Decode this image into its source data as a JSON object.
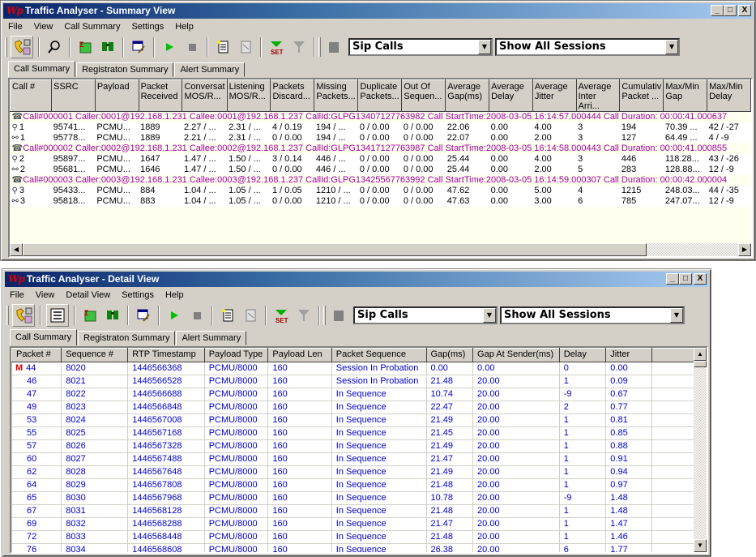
{
  "summary_window": {
    "logo": "Wp",
    "title": "Traffic Analyser - Summary View",
    "window_buttons": {
      "minimize": "_",
      "maximize": "□",
      "close": "X"
    },
    "menu": [
      "File",
      "View",
      "Call Summary",
      "Settings",
      "Help"
    ],
    "filter_combo": "Sip Calls",
    "session_combo": "Show All Sessions",
    "tabs": [
      "Call Summary",
      "Registraton Summary",
      "Alert Summary"
    ],
    "columns": [
      "Call #",
      "SSRC",
      "Payload",
      "Packet Received",
      "Conversat MOS/R...",
      "Listening MOS/R...",
      "Packets Discard...",
      "Missing Packets...",
      "Duplicate Packets...",
      "Out Of Sequen...",
      "Average Gap(ms)",
      "Average Delay",
      "Average Jitter",
      "Average Inter Arri...",
      "Cumulativ Packet ...",
      "Max/Min Gap",
      "Max/Min Delay"
    ],
    "calls": [
      {
        "header": "Call#000001  Caller:0001@192.168.1.231 Callee:0001@192.168.1.237 CallId:GLPG13407127763982 Call StartTime:2008-03-05 16:14:57.000444 Call Duration: 00:00:41.000637",
        "streams": [
          [
            "1",
            "95741...",
            "PCMU...",
            "1889",
            "2.27 / ...",
            "2.31 / ...",
            "4 / 0.19",
            "194 / ...",
            "0 / 0.00",
            "0 / 0.00",
            "22.06",
            "0.00",
            "4.00",
            "3",
            "194",
            "70.39 ...",
            "42 / -27"
          ],
          [
            "1",
            "95778...",
            "PCMU...",
            "1889",
            "2.21 / ...",
            "2.31 / ...",
            "0 / 0.00",
            "194 / ...",
            "0 / 0.00",
            "0 / 0.00",
            "22.07",
            "0.00",
            "2.00",
            "3",
            "127",
            "64.49 ...",
            "4 / -9"
          ]
        ]
      },
      {
        "header": "Call#000002  Caller:0002@192.168.1.231 Callee:0002@192.168.1.237 CallId:GLPG13417127763987 Call StartTime:2008-03-05 16:14:58.000443 Call Duration: 00:00:41.000855",
        "streams": [
          [
            "2",
            "95897...",
            "PCMU...",
            "1647",
            "1.47 / ...",
            "1.50 / ...",
            "3 / 0.14",
            "446 / ...",
            "0 / 0.00",
            "0 / 0.00",
            "25.44",
            "0.00",
            "4.00",
            "3",
            "446",
            "118.28...",
            "43 / -26"
          ],
          [
            "2",
            "95681...",
            "PCMU...",
            "1646",
            "1.47 / ...",
            "1.50 / ...",
            "0 / 0.00",
            "446 / ...",
            "0 / 0.00",
            "0 / 0.00",
            "25.44",
            "0.00",
            "2.00",
            "5",
            "283",
            "128.88...",
            "12 / -9"
          ]
        ]
      },
      {
        "header": "Call#000003  Caller:0003@192.168.1.231 Callee:0003@192.168.1.237 CallId:GLPG13425567763992 Call StartTime:2008-03-05 16:14:59.000307 Call Duration: 00:00:42.000004",
        "streams": [
          [
            "3",
            "95433...",
            "PCMU...",
            "884",
            "1.04 / ...",
            "1.05 / ...",
            "1 / 0.05",
            "1210 / ...",
            "0 / 0.00",
            "0 / 0.00",
            "47.62",
            "0.00",
            "5.00",
            "4",
            "1215",
            "248.03...",
            "44 / -35"
          ],
          [
            "3",
            "95818...",
            "PCMU...",
            "883",
            "1.04 / ...",
            "1.05 / ...",
            "0 / 0.00",
            "1210 / ...",
            "0 / 0.00",
            "0 / 0.00",
            "47.63",
            "0.00",
            "3.00",
            "6",
            "785",
            "247.07...",
            "12 / -9"
          ]
        ]
      }
    ]
  },
  "detail_window": {
    "logo": "Wp",
    "title": "Traffic Analyser - Detail View",
    "window_buttons": {
      "minimize": "_",
      "maximize": "□",
      "close": "X"
    },
    "menu": [
      "File",
      "View",
      "Detail View",
      "Settings",
      "Help"
    ],
    "filter_combo": "Sip Calls",
    "session_combo": "Show All Sessions",
    "tabs": [
      "Call Summary",
      "Registraton Summary",
      "Alert Summary"
    ],
    "columns": [
      "Packet #",
      "Sequence #",
      "RTP Timestamp",
      "Payload Type",
      "Payload Len",
      "Packet Sequence",
      "Gap(ms)",
      "Gap At Sender(ms)",
      "Delay",
      "Jitter",
      ""
    ],
    "marker_label": "M",
    "rows": [
      [
        "44",
        "8020",
        "1446566368",
        "PCMU/8000",
        "160",
        "Session In Probation",
        " 0.00",
        " 0.00",
        "0",
        "0.00"
      ],
      [
        "46",
        "8021",
        "1446566528",
        "PCMU/8000",
        "160",
        "Session In Probation",
        "21.48",
        "20.00",
        "1",
        "0.09"
      ],
      [
        "47",
        "8022",
        "1446566688",
        "PCMU/8000",
        "160",
        "In Sequence",
        "10.74",
        "20.00",
        "-9",
        "0.67"
      ],
      [
        "49",
        "8023",
        "1446566848",
        "PCMU/8000",
        "160",
        "In Sequence",
        "22.47",
        "20.00",
        "2",
        "0.77"
      ],
      [
        "53",
        "8024",
        "1446567008",
        "PCMU/8000",
        "160",
        "In Sequence",
        "21.49",
        "20.00",
        "1",
        "0.81"
      ],
      [
        "55",
        "8025",
        "1446567168",
        "PCMU/8000",
        "160",
        "In Sequence",
        "21.45",
        "20.00",
        "1",
        "0.85"
      ],
      [
        "57",
        "8026",
        "1446567328",
        "PCMU/8000",
        "160",
        "In Sequence",
        "21.49",
        "20.00",
        "1",
        "0.88"
      ],
      [
        "60",
        "8027",
        "1446567488",
        "PCMU/8000",
        "160",
        "In Sequence",
        "21.47",
        "20.00",
        "1",
        "0.91"
      ],
      [
        "62",
        "8028",
        "1446567648",
        "PCMU/8000",
        "160",
        "In Sequence",
        "21.49",
        "20.00",
        "1",
        "0.94"
      ],
      [
        "64",
        "8029",
        "1446567808",
        "PCMU/8000",
        "160",
        "In Sequence",
        "21.48",
        "20.00",
        "1",
        "0.97"
      ],
      [
        "65",
        "8030",
        "1446567968",
        "PCMU/8000",
        "160",
        "In Sequence",
        "10.78",
        "20.00",
        "-9",
        "1.48"
      ],
      [
        "67",
        "8031",
        "1446568128",
        "PCMU/8000",
        "160",
        "In Sequence",
        "21.48",
        "20.00",
        "1",
        "1.48"
      ],
      [
        "69",
        "8032",
        "1446568288",
        "PCMU/8000",
        "160",
        "In Sequence",
        "21.47",
        "20.00",
        "1",
        "1.47"
      ],
      [
        "72",
        "8033",
        "1446568448",
        "PCMU/8000",
        "160",
        "In Sequence",
        "21.48",
        "20.00",
        "1",
        "1.46"
      ],
      [
        "76",
        "8034",
        "1446568608",
        "PCMU/8000",
        "160",
        "In Sequence",
        "26.38",
        "20.00",
        "6",
        "1.77"
      ]
    ]
  },
  "colors": {
    "call_row_text": "#a000a0",
    "detail_text": "#0000cc",
    "marker": "#e00000",
    "title_gradient_start": "#0a246a",
    "title_gradient_end": "#a6caf0"
  }
}
